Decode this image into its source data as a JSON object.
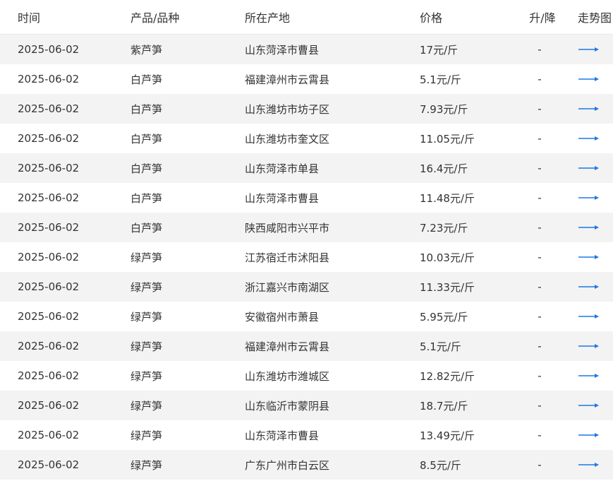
{
  "table": {
    "headers": [
      "时间",
      "产品/品种",
      "所在产地",
      "价格",
      "升/降",
      "走势图"
    ],
    "rows": [
      [
        "2025-06-02",
        "紫芦笋",
        "山东菏泽市曹县",
        "17元/斤",
        "-"
      ],
      [
        "2025-06-02",
        "白芦笋",
        "福建漳州市云霄县",
        "5.1元/斤",
        "-"
      ],
      [
        "2025-06-02",
        "白芦笋",
        "山东潍坊市坊子区",
        "7.93元/斤",
        "-"
      ],
      [
        "2025-06-02",
        "白芦笋",
        "山东潍坊市奎文区",
        "11.05元/斤",
        "-"
      ],
      [
        "2025-06-02",
        "白芦笋",
        "山东菏泽市单县",
        "16.4元/斤",
        "-"
      ],
      [
        "2025-06-02",
        "白芦笋",
        "山东菏泽市曹县",
        "11.48元/斤",
        "-"
      ],
      [
        "2025-06-02",
        "白芦笋",
        "陕西咸阳市兴平市",
        "7.23元/斤",
        "-"
      ],
      [
        "2025-06-02",
        "绿芦笋",
        "江苏宿迁市沭阳县",
        "10.03元/斤",
        "-"
      ],
      [
        "2025-06-02",
        "绿芦笋",
        "浙江嘉兴市南湖区",
        "11.33元/斤",
        "-"
      ],
      [
        "2025-06-02",
        "绿芦笋",
        "安徽宿州市萧县",
        "5.95元/斤",
        "-"
      ],
      [
        "2025-06-02",
        "绿芦笋",
        "福建漳州市云霄县",
        "5.1元/斤",
        "-"
      ],
      [
        "2025-06-02",
        "绿芦笋",
        "山东潍坊市潍城区",
        "12.82元/斤",
        "-"
      ],
      [
        "2025-06-02",
        "绿芦笋",
        "山东临沂市蒙阴县",
        "18.7元/斤",
        "-"
      ],
      [
        "2025-06-02",
        "绿芦笋",
        "山东菏泽市曹县",
        "13.49元/斤",
        "-"
      ],
      [
        "2025-06-02",
        "绿芦笋",
        "广东广州市白云区",
        "8.5元/斤",
        "-"
      ]
    ],
    "trend_icon": "right-arrow-icon",
    "trend_color": "#1e78e6"
  }
}
